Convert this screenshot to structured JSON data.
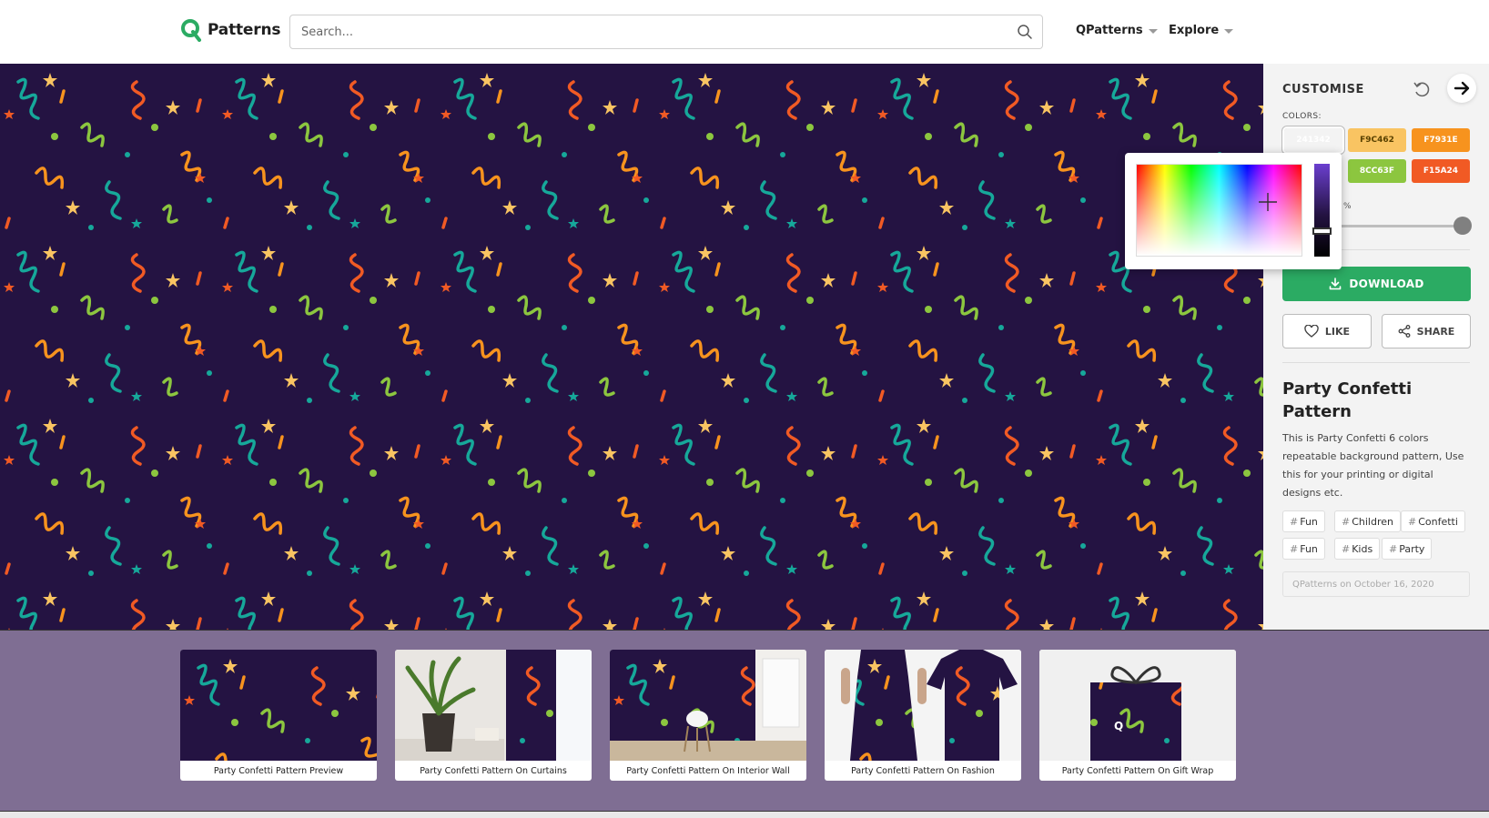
{
  "header": {
    "logo_text": "Patterns",
    "search_placeholder": "Search...",
    "nav": [
      {
        "label": "QPatterns"
      },
      {
        "label": "Explore"
      }
    ]
  },
  "sidebar": {
    "title": "CUSTOMISE",
    "colors_label": "COLORS:",
    "swatches": [
      {
        "hex": "241342",
        "color": "#241342",
        "selected": true
      },
      {
        "hex": "F9C462",
        "color": "#F9C462"
      },
      {
        "hex": "F7931E",
        "color": "#F7931E"
      },
      {
        "hex": "8CC63F",
        "color": "#8CC63F"
      },
      {
        "hex": "F15A24",
        "color": "#F15A24"
      }
    ],
    "scale_suffix": "%",
    "download_label": "DOWNLOAD",
    "like_label": "LIKE",
    "share_label": "SHARE",
    "pattern_title": "Party Confetti Pattern",
    "description": "This is Party Confetti 6 colors repeatable background pattern, Use this for your printing or digital designs etc.",
    "tags": [
      "Fun",
      "Children",
      "Confetti",
      "Fun",
      "Kids",
      "Party"
    ],
    "meta": "QPatterns on October 16, 2020"
  },
  "mockups": [
    {
      "caption": "Party Confetti Pattern Preview"
    },
    {
      "caption": "Party Confetti Pattern On Curtains"
    },
    {
      "caption": "Party Confetti Pattern On Interior Wall"
    },
    {
      "caption": "Party Confetti Pattern On Fashion"
    },
    {
      "caption": "Party Confetti Pattern On Gift Wrap"
    }
  ],
  "icons": {
    "search": "search-icon",
    "undo": "undo-icon",
    "next": "arrow-right-icon",
    "download": "download-icon",
    "like": "heart-icon",
    "share": "share-icon"
  },
  "palette": {
    "background": "#241342",
    "confetti": [
      "#F9C462",
      "#F7931E",
      "#8CC63F",
      "#F15A24",
      "#16A89A"
    ],
    "accent": "#2BAB63",
    "band": "#7F6E93"
  }
}
